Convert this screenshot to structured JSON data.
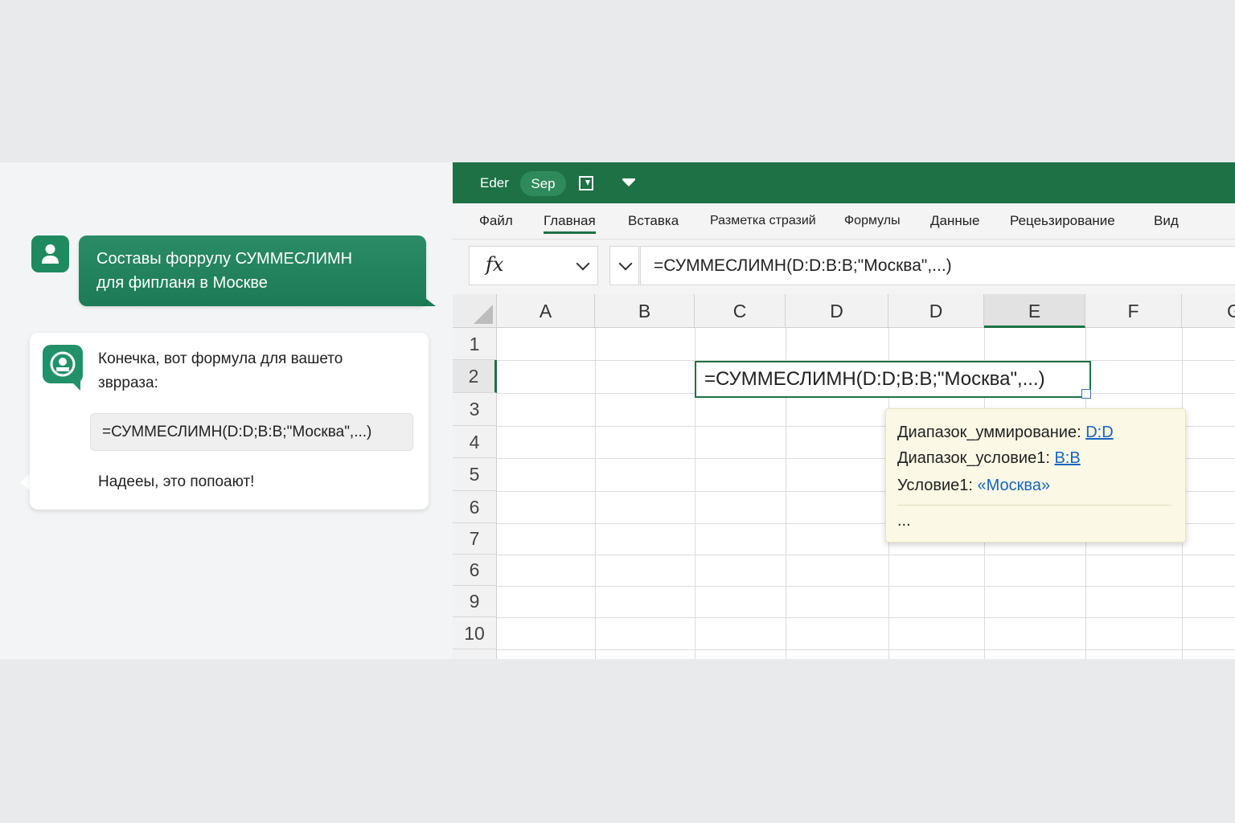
{
  "chat": {
    "user_message_lines": [
      "Составы форрулу СУММЕСЛИМН",
      "для фипланя в Москве"
    ],
    "bot_intro_lines": [
      "Конечка, вот формула для вашето",
      "зврраза:"
    ],
    "bot_code": "=СУММЕСЛИМН(D:D;B:B;\"Москва\",...)",
    "bot_closing": "Надееы, это попоают!",
    "user_avatar_icon": "user-icon",
    "bot_avatar_icon": "assistant-icon"
  },
  "excel": {
    "title_bar": {
      "app_label": "Eder",
      "pill_label": "Sep",
      "accent_color": "#1e7145"
    },
    "ribbon_tabs": [
      {
        "label": "Файл",
        "active": false
      },
      {
        "label": "Главная",
        "active": true
      },
      {
        "label": "Вставка",
        "active": false
      },
      {
        "label": "Разметка стразий",
        "active": false
      },
      {
        "label": "Формулы",
        "active": false
      },
      {
        "label": "Данные",
        "active": false
      },
      {
        "label": "Рецеьзирование",
        "active": false
      },
      {
        "label": "Вид",
        "active": false
      }
    ],
    "name_box_label": "fx",
    "formula_bar_value": "=СУММЕСЛИМН(D:D:B:B;\"Москва\",...)",
    "column_headers": [
      "A",
      "B",
      "C",
      "D",
      "D",
      "E",
      "F",
      "G"
    ],
    "selected_column": "E",
    "row_headers": [
      "1",
      "2",
      "3",
      "4",
      "5",
      "6",
      "7",
      "6",
      "9",
      "10"
    ],
    "selected_row": "2",
    "active_cell_value": "=СУММЕСЛИМН(D:D;B:B;\"Москва\",...)",
    "tooltip": {
      "arg1_label": "Диапазок_уммирование:",
      "arg1_value": "D:D",
      "arg2_label": "Диапазок_условие1:",
      "arg2_value": "B:B",
      "arg3_label": "Условие1:",
      "arg3_value": "«Москва»",
      "more": "..."
    }
  }
}
